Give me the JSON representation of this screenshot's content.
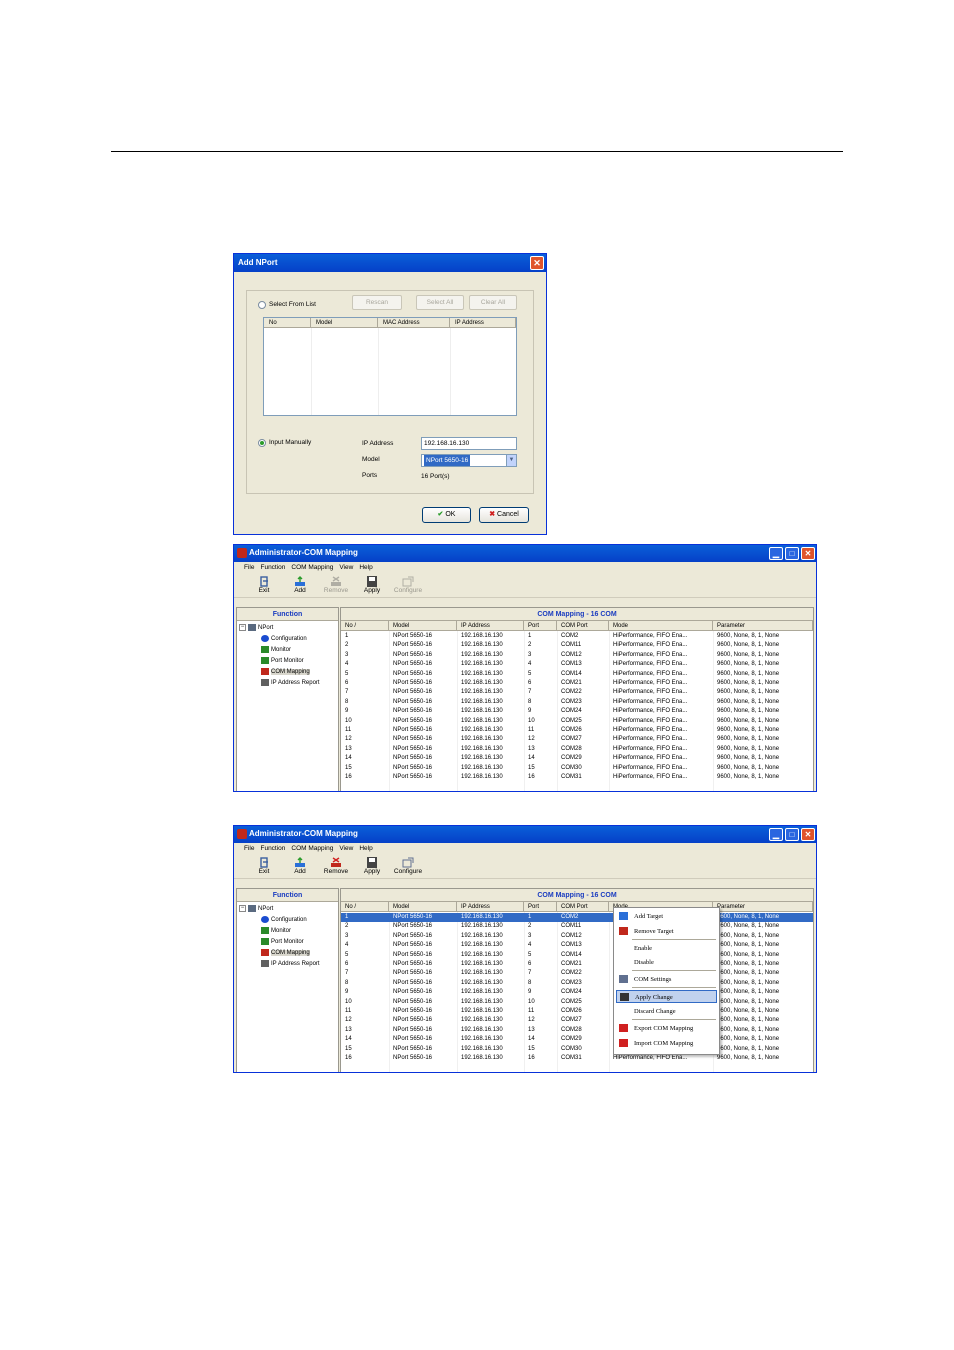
{
  "dialog": {
    "title": "Add NPort",
    "select_from_list": "Select From List",
    "rescan": "Rescan",
    "select_all": "Select All",
    "clear_all": "Clear All",
    "list_columns": [
      "No",
      "Model",
      "MAC Address",
      "IP Address"
    ],
    "input_manually": "Input Manually",
    "ip_address_label": "IP Address",
    "ip_address_value": "192.168.16.130",
    "model_label": "Model",
    "model_value": "NPort 5650-16",
    "ports_label": "Ports",
    "ports_value": "16 Port(s)",
    "ok": "OK",
    "cancel": "Cancel"
  },
  "window": {
    "title": "Administrator-COM Mapping",
    "menu": [
      "File",
      "Function",
      "COM Mapping",
      "View",
      "Help"
    ],
    "toolbar": [
      "Exit",
      "Add",
      "Remove",
      "Apply",
      "Configure"
    ],
    "function_header": "Function",
    "tree_root": "NPort",
    "tree": [
      "Configuration",
      "Monitor",
      "Port Monitor",
      "COM Mapping",
      "IP Address Report"
    ],
    "grid_header": "COM Mapping - 16 COM",
    "columns": [
      "No",
      "/",
      "Model",
      "IP Address",
      "Port",
      "COM Port",
      "Mode",
      "Parameter"
    ],
    "model": "NPort 5650-16",
    "ip": "192.168.16.130",
    "mode": "HiPerformance, FIFO Ena...",
    "parameter": "9600, None, 8, 1, None",
    "com_ports": [
      "COM2",
      "COM11",
      "COM12",
      "COM13",
      "COM14",
      "COM21",
      "COM22",
      "COM23",
      "COM24",
      "COM25",
      "COM26",
      "COM27",
      "COM28",
      "COM29",
      "COM30",
      "COM31"
    ]
  },
  "context_menu": [
    "Add Target",
    "Remove Target",
    "Enable",
    "Disable",
    "COM Settings",
    "Apply Change",
    "Discard Change",
    "Export COM Mapping",
    "Import COM Mapping"
  ]
}
